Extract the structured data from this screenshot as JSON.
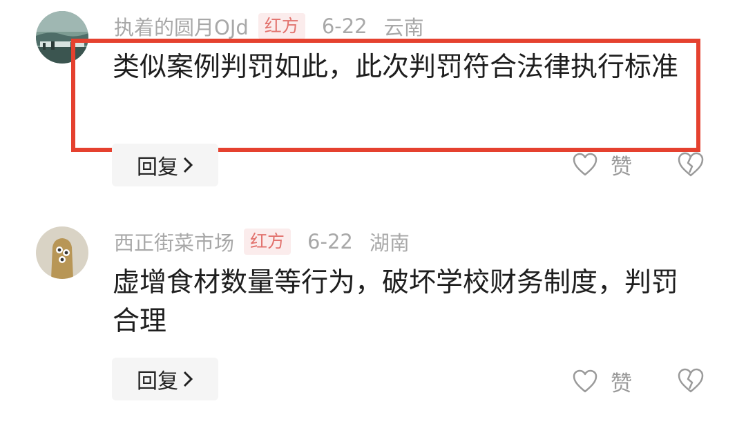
{
  "comments": [
    {
      "username": "执着的圆月OJd",
      "tag": "红方",
      "date": "6-22",
      "location": "云南",
      "text": "类似案例判罚如此，此次判罚符合法律执行标准",
      "reply_label": "回复",
      "like_label": "赞",
      "highlighted": true
    },
    {
      "username": "西正街菜市场",
      "tag": "红方",
      "date": "6-22",
      "location": "湖南",
      "text": "虚增食材数量等行为，破坏学校财务制度，判罚合理",
      "reply_label": "回复",
      "like_label": "赞",
      "highlighted": false
    }
  ],
  "colors": {
    "highlight_border": "#e5412f",
    "tag_bg": "#fbecec",
    "tag_text": "#e2726d",
    "meta_text": "#a8a8a8"
  },
  "icons": {
    "like": "heart-outline-icon",
    "dislike": "broken-heart-icon",
    "reply_chevron": "chevron-right-icon"
  }
}
